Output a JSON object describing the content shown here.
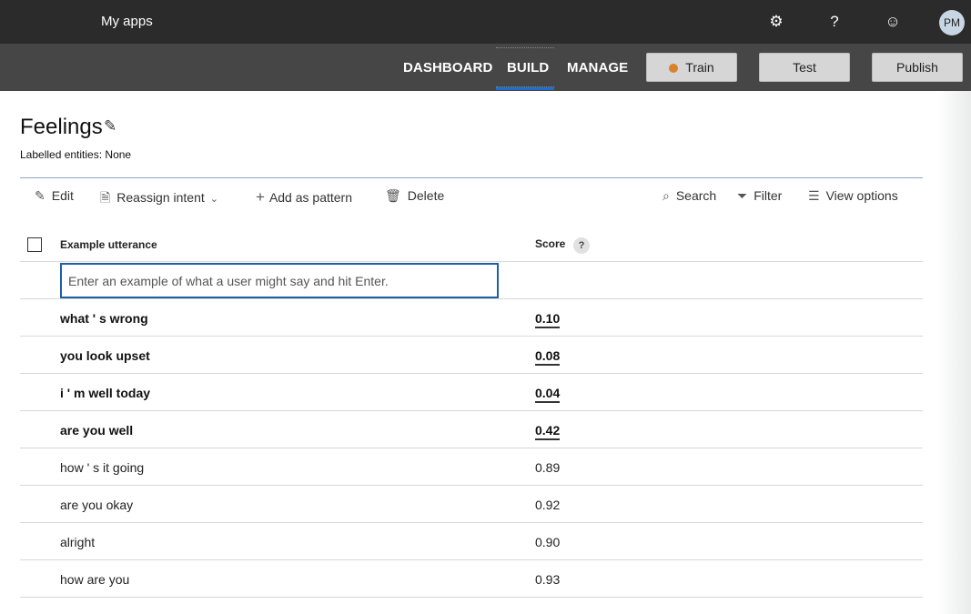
{
  "topbar": {
    "app_link": "My apps",
    "icons": [
      "settings-gear-icon",
      "help-icon",
      "feedback-smiley-icon"
    ],
    "help_glyph": "?",
    "avatar_initials": "PM"
  },
  "nav": {
    "tabs": [
      "DASHBOARD",
      "BUILD",
      "MANAGE"
    ],
    "active_tab": "BUILD",
    "train_label": "Train",
    "test_label": "Test",
    "publish_label": "Publish",
    "train_status_color": "#d9822b"
  },
  "intent": {
    "title": "Feelings",
    "labelled_entities": "Labelled entities: None"
  },
  "toolbar": {
    "edit": "Edit",
    "reassign": "Reassign intent",
    "add_pattern": "Add as pattern",
    "delete": "Delete",
    "search": "Search",
    "filter": "Filter",
    "view_options": "View options"
  },
  "table": {
    "col_utterance": "Example utterance",
    "col_score": "Score",
    "score_help": "?",
    "input_placeholder": "Enter an example of what a user might say and hit Enter.",
    "rows": [
      {
        "utterance": "what ' s wrong",
        "score": "0.10",
        "highlighted": true
      },
      {
        "utterance": "you look upset",
        "score": "0.08",
        "highlighted": true
      },
      {
        "utterance": "i ' m well today",
        "score": "0.04",
        "highlighted": true
      },
      {
        "utterance": "are you well",
        "score": "0.42",
        "highlighted": true
      },
      {
        "utterance": "how ' s it going",
        "score": "0.89",
        "highlighted": false
      },
      {
        "utterance": "are you okay",
        "score": "0.92",
        "highlighted": false
      },
      {
        "utterance": "alright",
        "score": "0.90",
        "highlighted": false
      },
      {
        "utterance": "how are you",
        "score": "0.93",
        "highlighted": false
      }
    ]
  }
}
